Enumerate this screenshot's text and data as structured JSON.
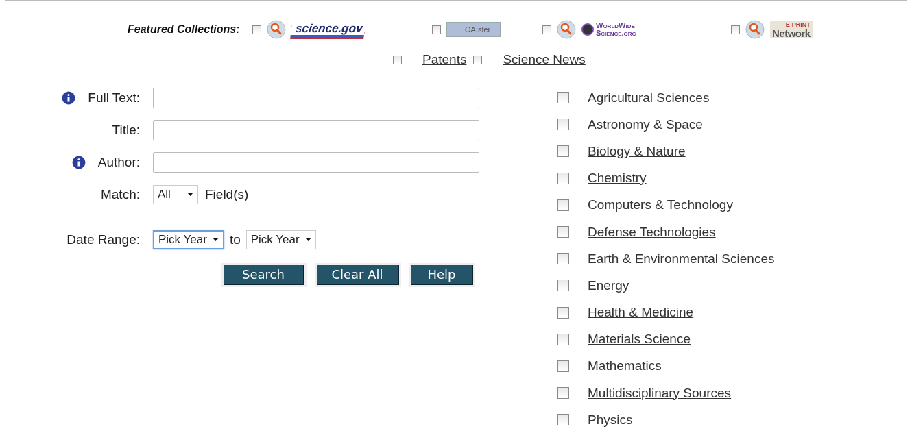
{
  "featured": {
    "label": "Featured Collections:",
    "collections": [
      {
        "kind": "sciencegov",
        "lines": [
          "science.gov"
        ],
        "search_icon": true,
        "checked": false
      },
      {
        "kind": "oaister",
        "lines": [
          "OAIster"
        ],
        "search_icon": false,
        "checked": false
      },
      {
        "kind": "worldwide",
        "lines": [
          "WorldWide",
          "Science.org"
        ],
        "search_icon": true,
        "checked": false
      },
      {
        "kind": "eprint",
        "lines": [
          "E-PRINT",
          "Network"
        ],
        "search_icon": true,
        "checked": false
      }
    ],
    "links": [
      {
        "label": "Patents",
        "checked": false
      },
      {
        "label": "Science News",
        "checked": false
      }
    ]
  },
  "form": {
    "fields": [
      {
        "label": "Full Text:",
        "info": true
      },
      {
        "label": "Title:",
        "info": false
      },
      {
        "label": "Author:",
        "info": true
      }
    ],
    "match": {
      "label": "Match:",
      "value": "All",
      "suffix": "Field(s)"
    },
    "date_range": {
      "label": "Date Range:",
      "from": {
        "value": "Pick Year",
        "focused": true
      },
      "connector": "to",
      "to": {
        "value": "Pick Year",
        "focused": false
      }
    },
    "buttons": [
      "Search",
      "Clear All",
      "Help"
    ]
  },
  "subjects": [
    {
      "label": "Agricultural Sciences",
      "checked": false
    },
    {
      "label": "Astronomy & Space",
      "checked": false
    },
    {
      "label": "Biology & Nature",
      "checked": false
    },
    {
      "label": "Chemistry",
      "checked": false
    },
    {
      "label": "Computers & Technology",
      "checked": false
    },
    {
      "label": "Defense Technologies",
      "checked": false
    },
    {
      "label": "Earth & Environmental Sciences",
      "checked": false
    },
    {
      "label": "Energy",
      "checked": false
    },
    {
      "label": "Health & Medicine",
      "checked": false
    },
    {
      "label": "Materials Science",
      "checked": false
    },
    {
      "label": "Mathematics",
      "checked": false
    },
    {
      "label": "Multidisciplinary Sources",
      "checked": false
    },
    {
      "label": "Physics",
      "checked": false
    }
  ]
}
